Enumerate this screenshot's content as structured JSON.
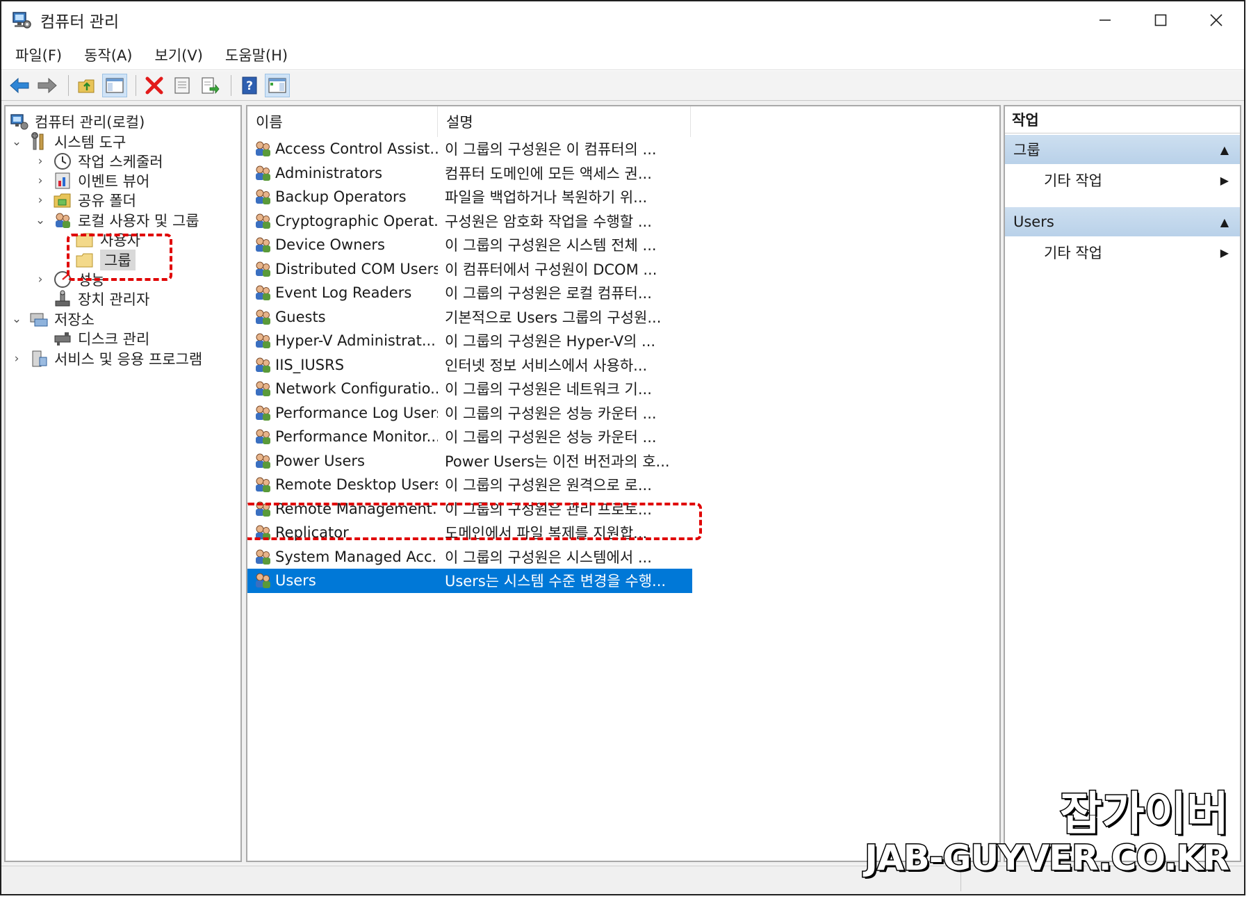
{
  "window": {
    "title": "컴퓨터 관리"
  },
  "menu": [
    "파일(F)",
    "동작(A)",
    "보기(V)",
    "도움말(H)"
  ],
  "toolbar": {
    "icons": [
      "back-arrow-icon",
      "forward-arrow-icon",
      "up-folder-icon",
      "show-hide-console-tree-icon",
      "delete-icon",
      "properties-icon",
      "export-list-icon",
      "help-icon",
      "show-hide-action-pane-icon"
    ]
  },
  "tree": {
    "root": "컴퓨터 관리(로컬)",
    "system_tools": "시스템 도구",
    "task_scheduler": "작업 스케줄러",
    "event_viewer": "이벤트 뷰어",
    "shared_folders": "공유 폴더",
    "local_users_groups": "로컬 사용자 및 그룹",
    "users": "사용자",
    "groups": "그룹",
    "performance": "성능",
    "device_manager": "장치 관리자",
    "storage": "저장소",
    "disk_management": "디스크 관리",
    "services_apps": "서비스 및 응용 프로그램"
  },
  "list": {
    "columns": {
      "name": "이름",
      "description": "설명"
    },
    "rows": [
      {
        "name": "Access Control Assist...",
        "desc": "이 그룹의 구성원은 이 컴퓨터의 ..."
      },
      {
        "name": "Administrators",
        "desc": "컴퓨터 도메인에 모든 액세스 권..."
      },
      {
        "name": "Backup Operators",
        "desc": "파일을 백업하거나 복원하기 위..."
      },
      {
        "name": "Cryptographic Operat...",
        "desc": "구성원은 암호화 작업을 수행할 ..."
      },
      {
        "name": "Device Owners",
        "desc": "이 그룹의 구성원은 시스템 전체 ..."
      },
      {
        "name": "Distributed COM Users",
        "desc": "이 컴퓨터에서 구성원이 DCOM ..."
      },
      {
        "name": "Event Log Readers",
        "desc": "이 그룹의 구성원은 로컬 컴퓨터..."
      },
      {
        "name": "Guests",
        "desc": "기본적으로 Users 그룹의 구성원..."
      },
      {
        "name": "Hyper-V Administrat...",
        "desc": "이 그룹의 구성원은 Hyper-V의 ..."
      },
      {
        "name": "IIS_IUSRS",
        "desc": "인터넷 정보 서비스에서 사용하..."
      },
      {
        "name": "Network Configuratio...",
        "desc": "이 그룹의 구성원은 네트워크 기..."
      },
      {
        "name": "Performance Log Users",
        "desc": "이 그룹의 구성원은 성능 카운터 ..."
      },
      {
        "name": "Performance Monitor...",
        "desc": "이 그룹의 구성원은 성능 카운터 ..."
      },
      {
        "name": "Power Users",
        "desc": "Power Users는 이전 버전과의 호..."
      },
      {
        "name": "Remote Desktop Users",
        "desc": "이 그룹의 구성원은 원격으로 로..."
      },
      {
        "name": "Remote Management...",
        "desc": "이 그룹의 구성원은 관리 프로토..."
      },
      {
        "name": "Replicator",
        "desc": "도메인에서 파일 복제를 지원합..."
      },
      {
        "name": "System Managed Acc...",
        "desc": "이 그룹의 구성원은 시스템에서 ..."
      },
      {
        "name": "Users",
        "desc": "Users는 시스템 수준 변경을 수행..."
      }
    ],
    "selected_index": 18
  },
  "actions": {
    "title": "작업",
    "section1": "그룹",
    "section1_item": "기타 작업",
    "section2": "Users",
    "section2_item": "기타 작업"
  },
  "watermark": {
    "korean": "잡가이버",
    "english": "JAB-GUYVER.CO.KR"
  },
  "colors": {
    "selection": "#0078d7",
    "annotation": "#e00000",
    "action_header": "#c5dbef"
  }
}
